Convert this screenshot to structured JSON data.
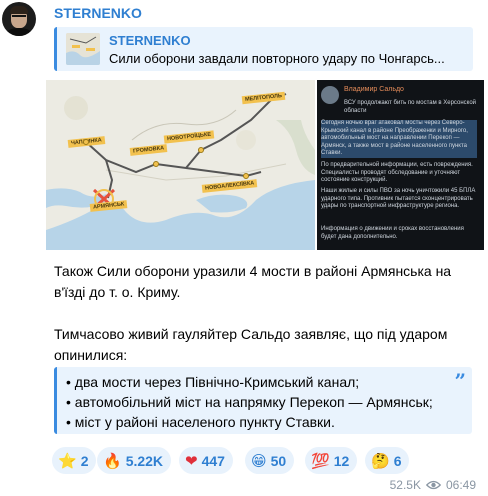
{
  "channel_name": "STERNENKO",
  "reply": {
    "name": "STERNENKO",
    "text": "Сили оборони завдали повторного удару по Чонгарсь..."
  },
  "map": {
    "labels": [
      "МЕЛІТОПОЛЬ",
      "ЧАПЛИНКА",
      "ГРОМОВКА",
      "НОВОТРОЇЦЬКЕ",
      "НОВОАЛЕКСІЇВКА",
      "АРМЯНСЬК"
    ]
  },
  "screenshot": {
    "author": "Владимир Сальдо",
    "headline": "ВСУ продолжают бить по мостам в Херсонской области",
    "para1": "Сегодня ночью враг атаковал мосты через Северо-Крымский канал в районе Преображенки и Мирного, автомобильный мост на направлении Перекоп — Армянск, а также мост в районе населенного пункта Ставки.",
    "para2": "По предварительной информации, есть повреждения. Специалисты проводят обследование и уточняют состояние конструкций.",
    "para3": "Наши жилые и силы ПВО за ночь уничтожили 45 БПЛА ударного типа. Противник пытается сконцентрировать удары по транспортной инфраструктуре региона.",
    "para4": "Информация о движении и сроках восстановления будет дана дополнительно."
  },
  "message": {
    "paragraph1": "Також Сили оборони уразили 4 мости в районі Армянська на в'їзді до т. о. Криму.",
    "paragraph1_line1": "Також Сили оборони уразили 4 мости в районі Армянська на",
    "paragraph1_line2": "в'їзді до т. о. Криму.",
    "paragraph2_line1": "Тимчасово живий гауляйтер Сальдо заявляє, що під ударом",
    "paragraph2_line2": "опинилися:"
  },
  "quote_items": [
    "• два мости через Північно-Кримський канал;",
    "• автомобільний міст на напрямку Перекоп — Армянськ;",
    "• міст у районі населеного пункту Ставки."
  ],
  "reactions": [
    {
      "emoji": "⭐",
      "count": "2",
      "icon": "star-icon"
    },
    {
      "emoji": "🔥",
      "count": "5.22K",
      "icon": "fire-icon"
    },
    {
      "emoji": "❤",
      "count": "447",
      "icon": "heart-icon"
    },
    {
      "emoji": "😁",
      "count": "50",
      "icon": "grin-icon"
    },
    {
      "emoji": "💯",
      "count": "12",
      "icon": "hundred-icon"
    },
    {
      "emoji": "🤔",
      "count": "6",
      "icon": "thinking-icon"
    }
  ],
  "meta": {
    "views": "52.5K",
    "time": "06:49"
  },
  "colors": {
    "accent": "#2f7fd1",
    "quote_bg": "#e9f3fd",
    "reaction_bg": "#e8f2fc"
  }
}
